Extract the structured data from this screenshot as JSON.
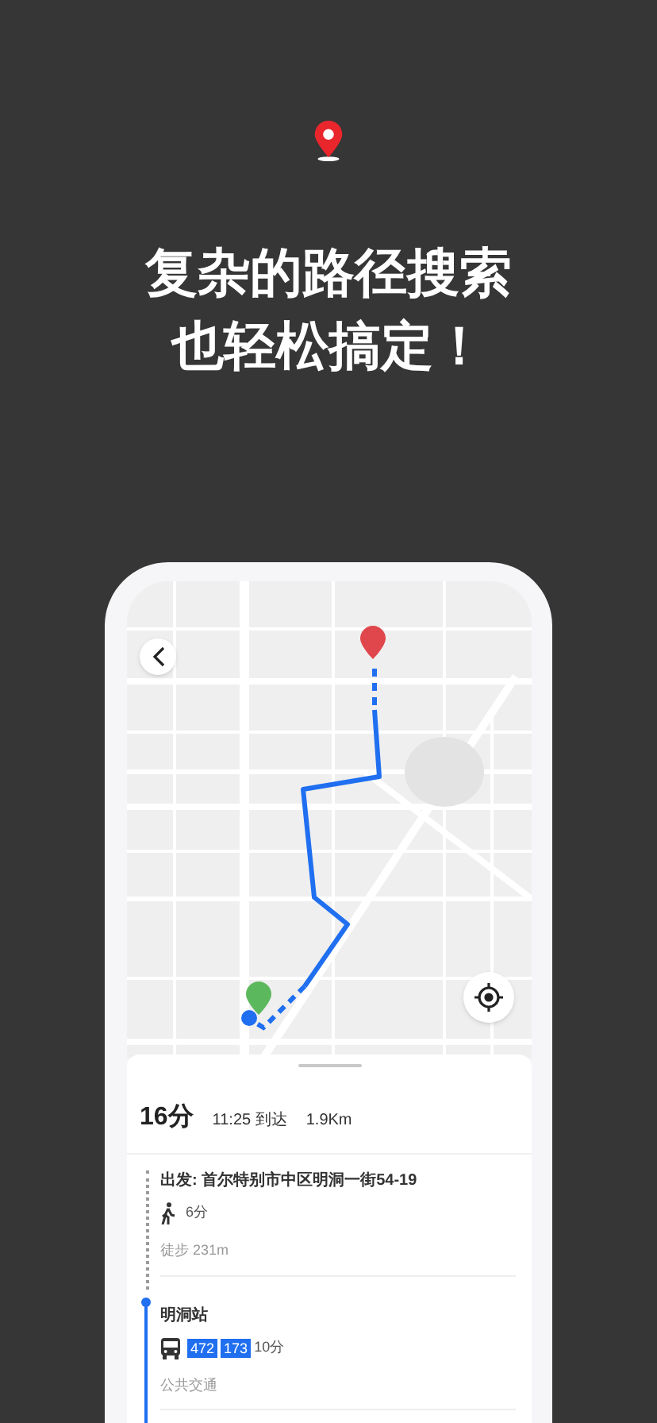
{
  "headline": [
    "复杂的路径搜索",
    "也轻松搞定！"
  ],
  "summary": {
    "duration": "16分",
    "arrival": "11:25 到达",
    "distance": "1.9Km"
  },
  "steps": [
    {
      "kind": "walk",
      "title": "出发: 首尔特别市中区明洞一街54-19",
      "duration": "6分",
      "caption": "徒步 231m"
    },
    {
      "kind": "bus",
      "title": "明洞站",
      "routes": [
        "472",
        "173"
      ],
      "duration": "10分",
      "caption": "公共交通"
    }
  ]
}
